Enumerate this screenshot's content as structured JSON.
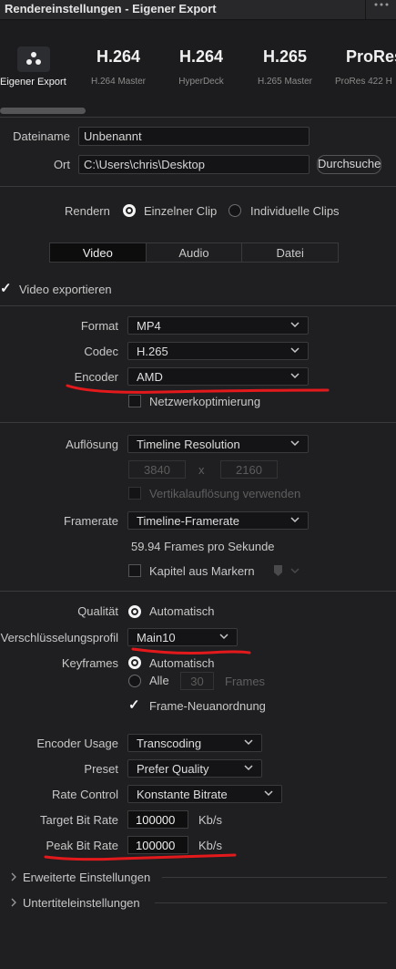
{
  "window": {
    "title": "Rendereinstellungen - Eigener Export",
    "menu_icon": "more-dots-icon"
  },
  "presets": [
    {
      "name": "",
      "sub": "Eigener Export",
      "icon": "davinci-logo-icon",
      "selected": true
    },
    {
      "name": "H.264",
      "sub": "H.264 Master"
    },
    {
      "name": "H.264",
      "sub": "HyperDeck"
    },
    {
      "name": "H.265",
      "sub": "H.265 Master"
    },
    {
      "name": "ProRes",
      "sub": "ProRes 422 H"
    }
  ],
  "file": {
    "name_label": "Dateiname",
    "name_value": "Unbenannt",
    "location_label": "Ort",
    "location_value": "C:\\Users\\chris\\Desktop",
    "browse_label": "Durchsuchen"
  },
  "render": {
    "label": "Rendern",
    "option_single": "Einzelner Clip",
    "option_individual": "Individuelle Clips",
    "selected": "single"
  },
  "tabs": [
    "Video",
    "Audio",
    "Datei"
  ],
  "video_export": {
    "label": "Video exportieren",
    "checked": true
  },
  "format": {
    "format_label": "Format",
    "format_value": "MP4",
    "codec_label": "Codec",
    "codec_value": "H.265",
    "encoder_label": "Encoder",
    "encoder_value": "AMD",
    "network_label": "Netzwerkoptimierung",
    "network_checked": false
  },
  "resolution": {
    "label": "Auflösung",
    "value": "Timeline Resolution",
    "width": "3840",
    "x": "x",
    "height": "2160",
    "vertical_label": "Vertikalauflösung verwenden",
    "framerate_label": "Framerate",
    "framerate_value": "Timeline-Framerate",
    "fps_text": "59.94 Frames pro Sekunde",
    "chapters_label": "Kapitel aus Markern"
  },
  "quality": {
    "label": "Qualität",
    "value": "Automatisch",
    "profile_label": "Verschlüsselungsprofil",
    "profile_value": "Main10",
    "keyframes_label": "Keyframes",
    "keyframes_auto": "Automatisch",
    "keyframes_every": "Alle",
    "keyframes_count": "30",
    "keyframes_unit": "Frames",
    "reorder_label": "Frame-Neuanordnung",
    "reorder_checked": true
  },
  "encoding": {
    "usage_label": "Encoder Usage",
    "usage_value": "Transcoding",
    "preset_label": "Preset",
    "preset_value": "Prefer Quality",
    "rate_label": "Rate Control",
    "rate_value": "Konstante Bitrate",
    "target_label": "Target Bit Rate",
    "target_value": "100000",
    "target_unit": "Kb/s",
    "peak_label": "Peak Bit Rate",
    "peak_value": "100000",
    "peak_unit": "Kb/s"
  },
  "sections": [
    "Erweiterte Einstellungen",
    "Untertiteleinstellungen"
  ],
  "colors": {
    "background": "#1f1f21",
    "field": "#141416",
    "annotation": "#e4191c",
    "text": "#c8c8c8"
  }
}
